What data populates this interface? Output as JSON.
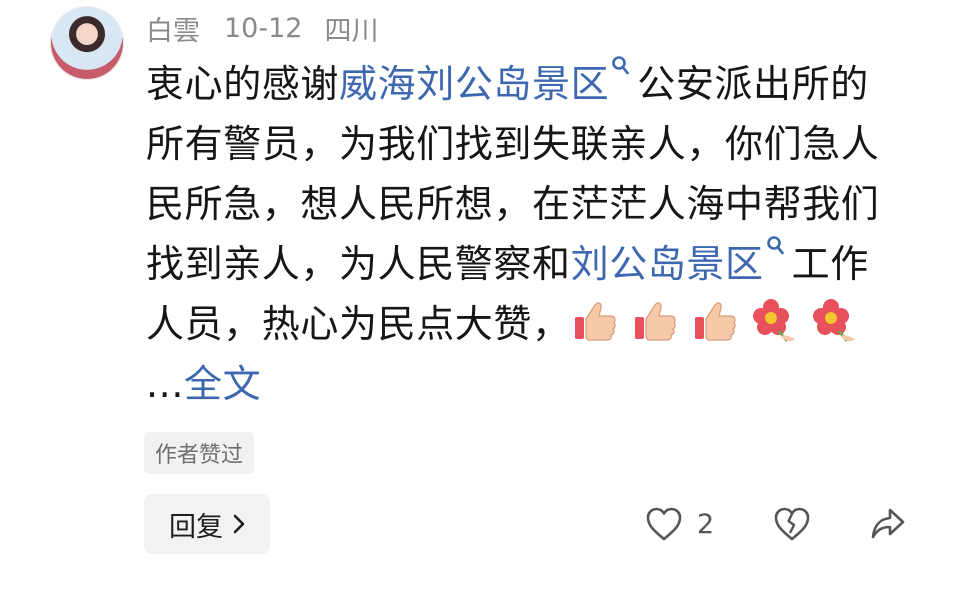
{
  "comment": {
    "author": "白雲",
    "date": "10-12",
    "location": "四川",
    "text_1": "衷心的感谢",
    "link_1": "威海刘公岛景区",
    "text_2": "公安派出所的所有警员，为我们找到失联亲人，你们急人民所急，想人民所想，在茫茫人海中帮我们找到亲人，为人民警察和",
    "link_2": "刘公岛景区",
    "text_3": "工作人员，热心为民点大赞，",
    "ellipsis": "...",
    "more_label": "全文",
    "emoji": [
      "thumbs-up",
      "thumbs-up",
      "thumbs-up",
      "flower",
      "flower"
    ]
  },
  "badge": {
    "label": "作者赞过"
  },
  "actions": {
    "reply_label": "回复",
    "like_count": "2"
  },
  "colors": {
    "link": "#3d68b0",
    "meta": "#8a8a8a",
    "text": "#161616"
  },
  "icons": {
    "search": "search-icon",
    "like": "heart-outline-icon",
    "dislike": "broken-heart-icon",
    "share": "share-arrow-icon",
    "reply_chevron": "chevron-right-icon"
  }
}
